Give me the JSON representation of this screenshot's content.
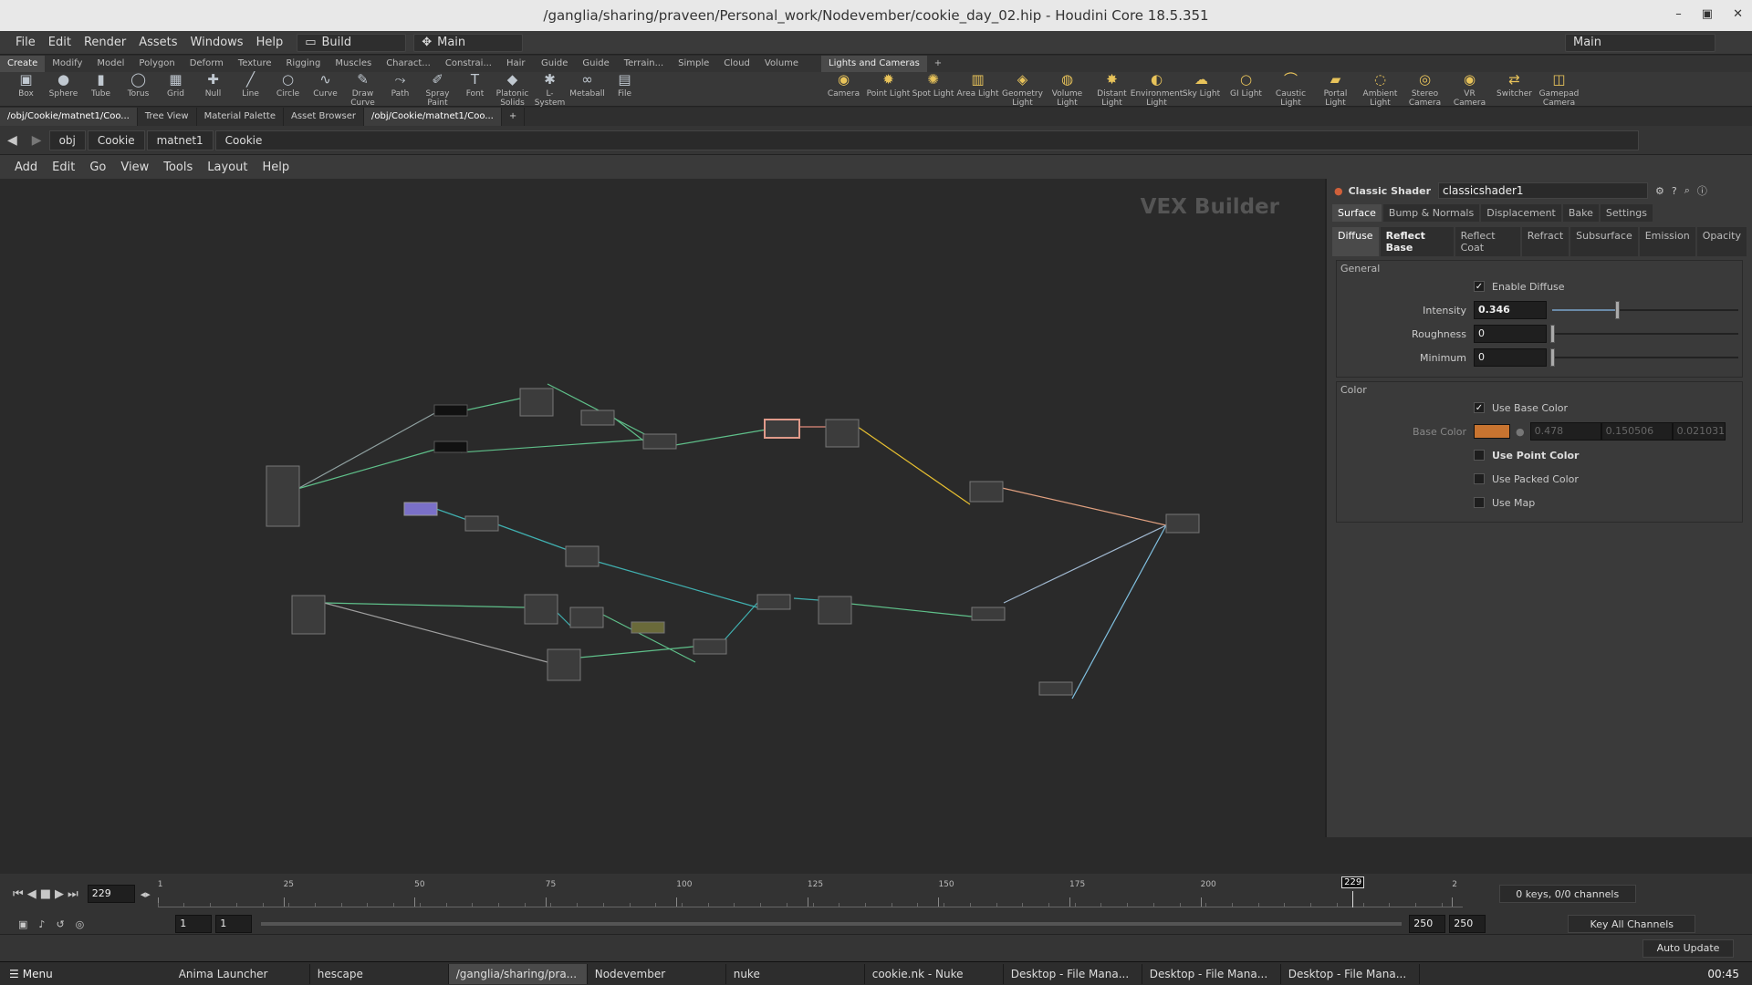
{
  "window": {
    "title": "/ganglia/sharing/praveen/Personal_work/Nodevember/cookie_day_02.hip - Houdini Core 18.5.351"
  },
  "menubar": {
    "items": [
      "File",
      "Edit",
      "Render",
      "Assets",
      "Windows",
      "Help"
    ],
    "desktop": "Build",
    "main": "Main",
    "right_main": "Main"
  },
  "shelf": {
    "tabs_left": [
      "Create",
      "Modify",
      "Model",
      "Polygon",
      "Deform",
      "Texture",
      "Rigging",
      "Muscles",
      "Charact...",
      "Constrai...",
      "Hair Utils",
      "Guide P...",
      "Guide B...",
      "Terrain...",
      "Simple FX",
      "Cloud FX",
      "Volume"
    ],
    "tools_left": [
      {
        "label": "Box",
        "icon": "box-icon"
      },
      {
        "label": "Sphere",
        "icon": "sphere-icon"
      },
      {
        "label": "Tube",
        "icon": "tube-icon"
      },
      {
        "label": "Torus",
        "icon": "torus-icon"
      },
      {
        "label": "Grid",
        "icon": "grid-icon"
      },
      {
        "label": "Null",
        "icon": "null-icon"
      },
      {
        "label": "Line",
        "icon": "line-icon"
      },
      {
        "label": "Circle",
        "icon": "circle-icon"
      },
      {
        "label": "Curve",
        "icon": "curve-icon"
      },
      {
        "label": "Draw Curve",
        "icon": "draw-curve-icon"
      },
      {
        "label": "Path",
        "icon": "path-icon"
      },
      {
        "label": "Spray Paint",
        "icon": "spray-paint-icon"
      },
      {
        "label": "Font",
        "icon": "font-icon"
      },
      {
        "label": "Platonic Solids",
        "icon": "platonic-icon"
      },
      {
        "label": "L-System",
        "icon": "lsystem-icon"
      },
      {
        "label": "Metaball",
        "icon": "metaball-icon"
      },
      {
        "label": "File",
        "icon": "file-icon"
      }
    ],
    "tab_right": "Lights and Cameras",
    "tools_right": [
      {
        "label": "Camera",
        "icon": "camera-icon"
      },
      {
        "label": "Point Light",
        "icon": "point-light-icon"
      },
      {
        "label": "Spot Light",
        "icon": "spot-light-icon"
      },
      {
        "label": "Area Light",
        "icon": "area-light-icon"
      },
      {
        "label": "Geometry Light",
        "icon": "geometry-light-icon"
      },
      {
        "label": "Volume Light",
        "icon": "volume-light-icon"
      },
      {
        "label": "Distant Light",
        "icon": "distant-light-icon"
      },
      {
        "label": "Environment Light",
        "icon": "environment-light-icon"
      },
      {
        "label": "Sky Light",
        "icon": "sky-light-icon"
      },
      {
        "label": "GI Light",
        "icon": "gi-light-icon"
      },
      {
        "label": "Caustic Light",
        "icon": "caustic-light-icon"
      },
      {
        "label": "Portal Light",
        "icon": "portal-light-icon"
      },
      {
        "label": "Ambient Light",
        "icon": "ambient-light-icon"
      },
      {
        "label": "Stereo Camera",
        "icon": "stereo-camera-icon"
      },
      {
        "label": "VR Camera",
        "icon": "vr-camera-icon"
      },
      {
        "label": "Switcher",
        "icon": "switcher-icon"
      },
      {
        "label": "Gamepad Camera",
        "icon": "gamepad-camera-icon"
      }
    ]
  },
  "pane_tabs": [
    "/obj/Cookie/matnet1/Coo...",
    "Tree View",
    "Material Palette",
    "Asset Browser",
    "/obj/Cookie/matnet1/Coo..."
  ],
  "breadcrumb": [
    "obj",
    "Cookie",
    "matnet1",
    "Cookie"
  ],
  "net_menu": [
    "Add",
    "Edit",
    "Go",
    "View",
    "Tools",
    "Layout",
    "Help"
  ],
  "network": {
    "context_label": "VEX Builder"
  },
  "params": {
    "node_type": "Classic Shader",
    "node_name": "classicshader1",
    "tabs": [
      "Surface",
      "Bump & Normals",
      "Displacement",
      "Bake",
      "Settings"
    ],
    "subtabs": [
      "Diffuse",
      "Reflect Base",
      "Reflect Coat",
      "Refract",
      "Subsurface",
      "Emission",
      "Opacity"
    ],
    "general": {
      "title": "General",
      "enable_diffuse": "Enable Diffuse",
      "intensity_label": "Intensity",
      "intensity": "0.346",
      "intensity_frac": 0.346,
      "roughness_label": "Roughness",
      "roughness": "0",
      "minimum_label": "Minimum",
      "minimum": "0"
    },
    "color": {
      "title": "Color",
      "use_base_color": "Use Base Color",
      "base_color_label": "Base Color",
      "base_color_hex": "#c87430",
      "r": "0.478",
      "g": "0.150506",
      "b": "0.021031",
      "use_point_color": "Use Point Color",
      "use_packed_color": "Use Packed Color",
      "use_map": "Use Map"
    }
  },
  "timeline": {
    "frame": "229",
    "ticks": [
      "1",
      "25",
      "50",
      "75",
      "100",
      "125",
      "150",
      "175",
      "200",
      "2"
    ],
    "marker": "229",
    "start": "1",
    "start2": "1",
    "end": "250",
    "end2": "250",
    "keys": "0 keys, 0/0 channels",
    "key_all": "Key All Channels",
    "auto_update": "Auto Update"
  },
  "taskbar": {
    "menu": "Menu",
    "tasks": [
      "Anima Launcher",
      "hescape",
      "/ganglia/sharing/pra...",
      "Nodevember",
      "nuke",
      "cookie.nk - Nuke",
      "Desktop - File Mana...",
      "Desktop - File Mana...",
      "Desktop - File Mana..."
    ],
    "clock": "00:45"
  }
}
